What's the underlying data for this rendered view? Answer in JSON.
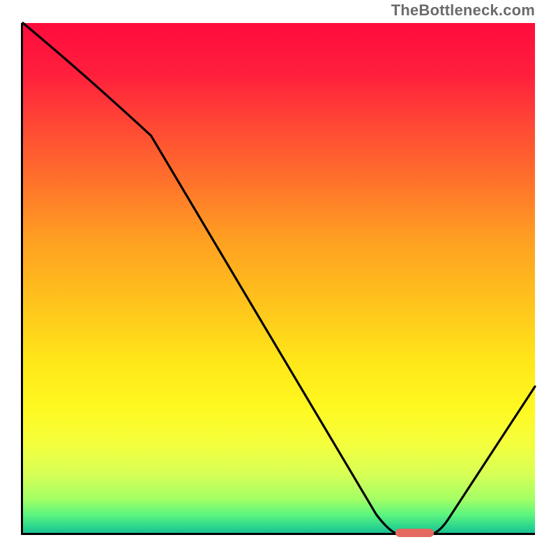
{
  "watermark": "TheBottleneck.com",
  "chart_data": {
    "type": "line",
    "title": "",
    "xlabel": "",
    "ylabel": "",
    "xlim": [
      0,
      100
    ],
    "ylim": [
      0,
      100
    ],
    "grid": false,
    "legend": false,
    "x": [
      0,
      25,
      72,
      81,
      100
    ],
    "y": [
      100,
      78,
      0,
      0,
      29
    ],
    "annotations": [
      {
        "kind": "marker",
        "shape": "pill",
        "color": "#e46a61",
        "x_center": 76.5,
        "y": 0,
        "width_pct": 7.5,
        "height_pct": 1.6
      }
    ],
    "background": {
      "type": "vertical_gradient",
      "stops": [
        {
          "pos": 0,
          "color": "#ff0c3d"
        },
        {
          "pos": 20,
          "color": "#ff4835"
        },
        {
          "pos": 42,
          "color": "#ff9f22"
        },
        {
          "pos": 66,
          "color": "#ffe619"
        },
        {
          "pos": 82,
          "color": "#f5ff3c"
        },
        {
          "pos": 93,
          "color": "#a4ff65"
        },
        {
          "pos": 100,
          "color": "#15b894"
        }
      ]
    }
  }
}
